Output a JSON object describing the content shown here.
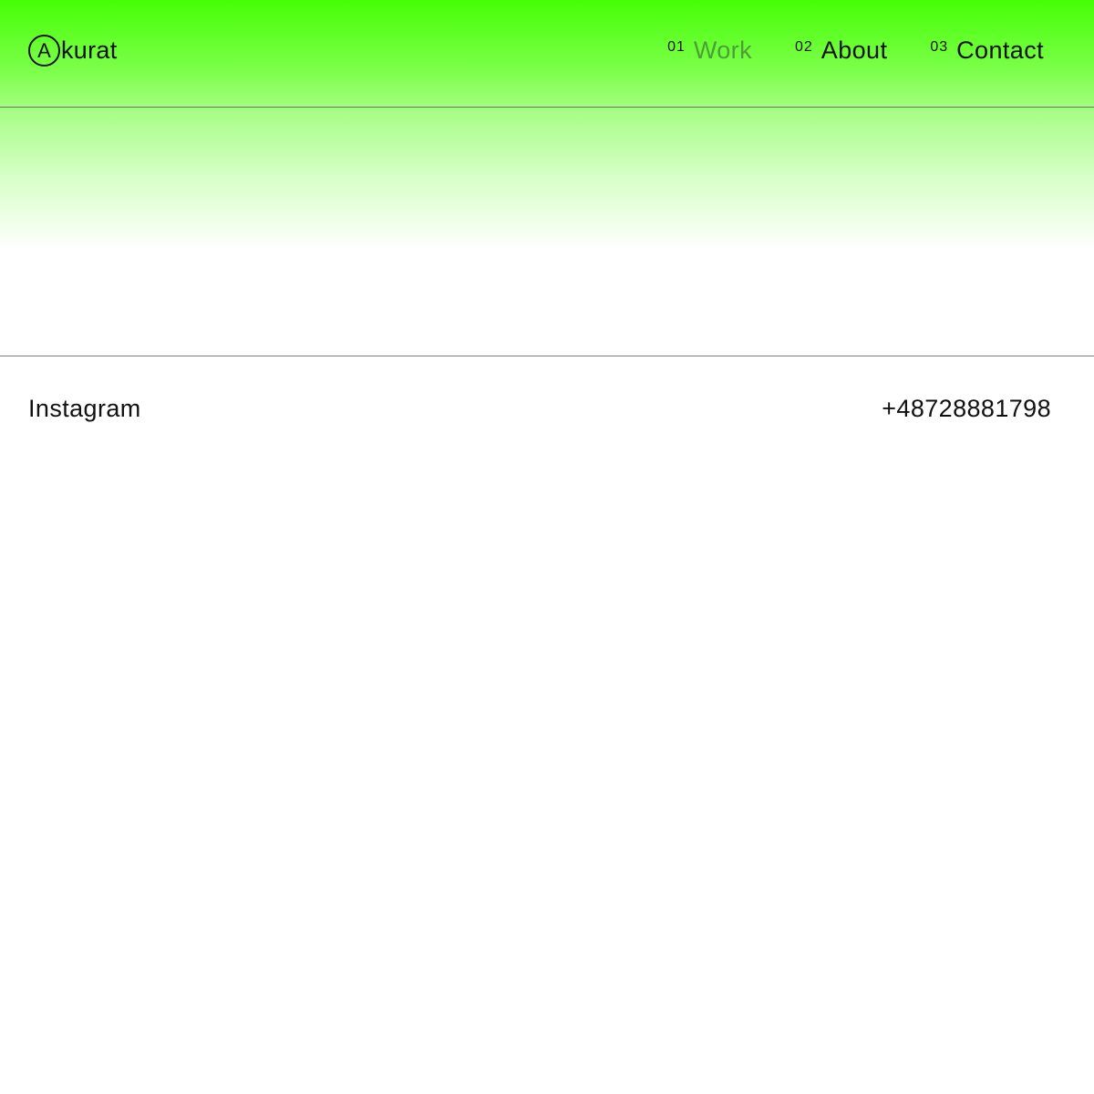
{
  "brand": {
    "logo_letter": "A",
    "logo_text": "kurat"
  },
  "nav": {
    "items": [
      {
        "number": "01",
        "label": "Work",
        "active": true
      },
      {
        "number": "02",
        "label": "About",
        "active": false
      },
      {
        "number": "03",
        "label": "Contact",
        "active": false
      }
    ]
  },
  "contact": {
    "instagram_label": "Instagram",
    "phone": "+48728881798"
  },
  "colors": {
    "accent_green": "#46ff06",
    "active_nav": "#4d9e3a",
    "text": "#111111"
  }
}
